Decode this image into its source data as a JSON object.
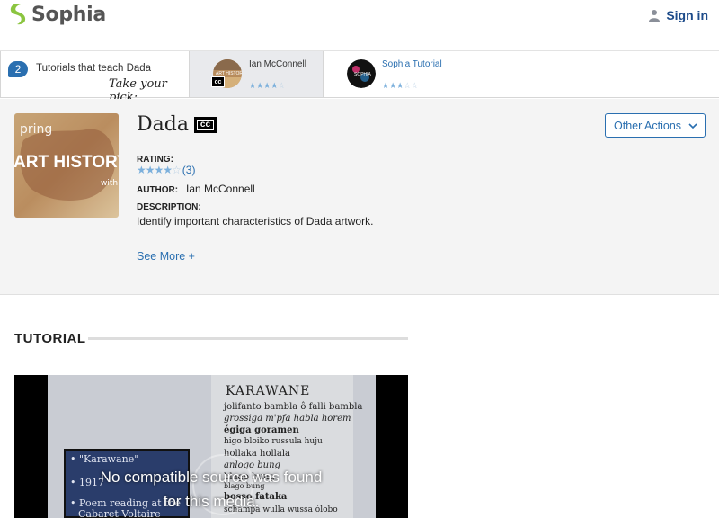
{
  "header": {
    "brand": "Sophia",
    "signin_label": "Sign in",
    "brand_color": "#8bc540",
    "link_color": "#1d4b8a"
  },
  "strip": {
    "count": "2",
    "label": "Tutorials that teach Dada",
    "pick_label": "Take your pick:",
    "cards": [
      {
        "author": "Ian McConnell",
        "stars": "★★★★☆",
        "rating": 4,
        "cc": "cc",
        "thumb_icon": "art-history-thumbnail-icon"
      },
      {
        "author": "Sophia Tutorial",
        "stars": "★★★☆☆",
        "rating": 3,
        "thumb_icon": "sophia-logo-thumbnail-icon"
      }
    ]
  },
  "info": {
    "title": "Dada",
    "cc_label": "cc",
    "rating_label": "RATING:",
    "stars": "★★★★☆",
    "rating_value": 4.5,
    "rating_count": "(3)",
    "author_label": "AUTHOR:",
    "author": "Ian McConnell",
    "description_label": "DESCRIPTION:",
    "description": "Identify important characteristics of Dada artwork.",
    "see_more": "See More +",
    "other_actions": "Other Actions",
    "cover_text_top": "pring",
    "cover_text_main": "ART HISTORY",
    "cover_text_sub": "with"
  },
  "tutorial": {
    "section_title": "TUTORIAL",
    "poem_title": "KARAWANE",
    "poem_lines": [
      "jolifanto bambla ô falli bambla",
      "grossiga m'pfa habla horem",
      "égiga goramen",
      "higo bloiko russula huju",
      "hollaka hollala",
      "anlogo bung",
      "blago bung",
      "blago bung",
      "bosso fataka",
      "schampa wulla wussa ólobo"
    ],
    "note_lines": [
      "• \"Karawane\"",
      "• 1917",
      "• Poem reading at the",
      "Cabaret Voltaire"
    ],
    "message_line1": "No compatible source was found",
    "message_line2": "for this media."
  }
}
